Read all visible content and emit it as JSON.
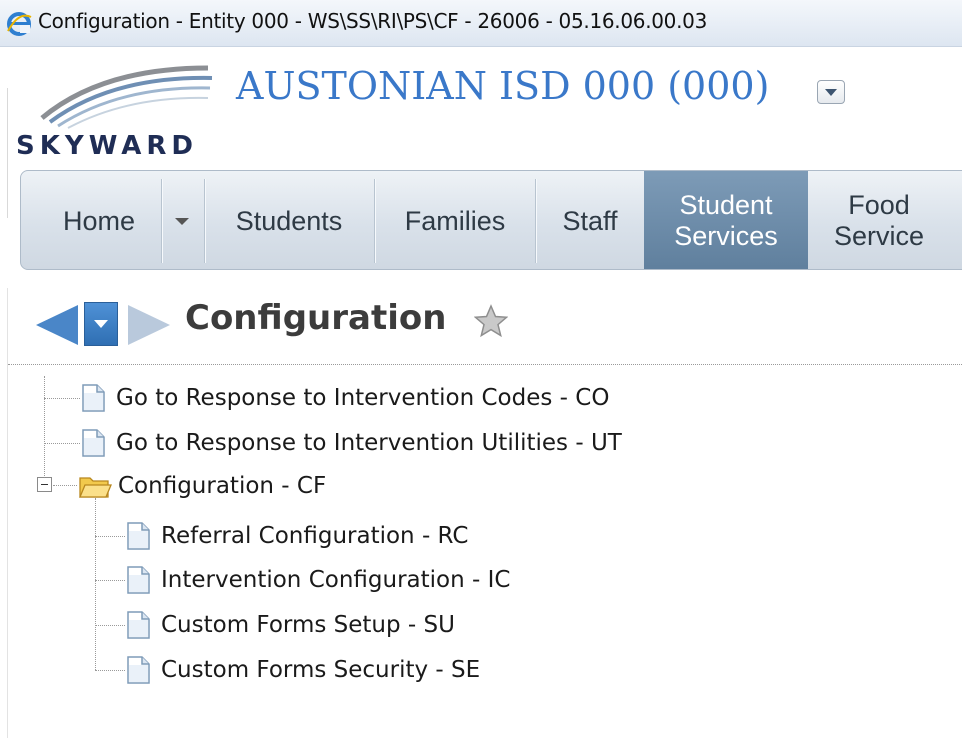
{
  "window": {
    "title": "Configuration - Entity 000 - WS\\SS\\RI\\PS\\CF - 26006 - 05.16.06.00.03",
    "browser_icon": "internet-explorer-icon"
  },
  "header": {
    "logo_text": "SKYWARD",
    "district": "AUSTONIAN ISD 000 (000)",
    "district_dropdown_icon": "chevron-down-icon"
  },
  "nav": {
    "items": [
      {
        "label": "Home",
        "active": false
      },
      {
        "label": "Students",
        "active": false
      },
      {
        "label": "Families",
        "active": false
      },
      {
        "label": "Staff",
        "active": false
      },
      {
        "label": "Student Services",
        "line1": "Student",
        "line2": "Services",
        "active": true
      },
      {
        "label": "Food Service",
        "line1": "Food",
        "line2": "Service",
        "active": false
      }
    ]
  },
  "page": {
    "title": "Configuration",
    "favorite_icon": "star-icon",
    "back_icon": "arrow-left-icon",
    "forward_icon": "arrow-right-icon",
    "history_icon": "chevron-down-icon"
  },
  "tree": {
    "top_items": [
      {
        "label": "Go to Response to Intervention Codes - CO",
        "icon": "document-icon"
      },
      {
        "label": "Go to Response to Intervention Utilities - UT",
        "icon": "document-icon"
      }
    ],
    "folder": {
      "label": "Configuration - CF",
      "icon": "folder-open-icon",
      "expanded": true,
      "children": [
        {
          "label": "Referral Configuration - RC",
          "icon": "document-icon"
        },
        {
          "label": "Intervention Configuration - IC",
          "icon": "document-icon"
        },
        {
          "label": "Custom Forms Setup - SU",
          "icon": "document-icon"
        },
        {
          "label": "Custom Forms Security - SE",
          "icon": "document-icon"
        }
      ]
    }
  },
  "colors": {
    "district_blue": "#3a78c9",
    "nav_active": "#6b8aa8",
    "arrow_blue": "#4a86c8"
  }
}
